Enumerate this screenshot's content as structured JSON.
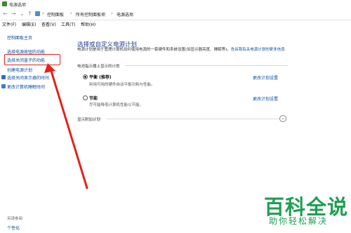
{
  "window": {
    "title": "电源选项"
  },
  "address": {
    "back": "←",
    "forward": "→",
    "recent": "⌄",
    "up": "↑",
    "crumbs": [
      "控制面板",
      "所有控制面板项",
      "电源选项"
    ],
    "sep": "›"
  },
  "menu": [
    "文件(F)",
    "编辑(E)",
    "查看(V)",
    "工具(T)",
    "帮助(H)"
  ],
  "sidebar": {
    "home": "控制面板主页",
    "items": [
      "选择电源按钮的功能",
      "选择关闭盖子的功能",
      "创建电源计划",
      "选择关闭显示器的时间",
      "更改计算机睡眠时间"
    ],
    "see_also": "另请参阅",
    "personalize": "个性化"
  },
  "main": {
    "title": "选择或自定义电源计划",
    "desc": "电源计划是用于管理计算机如何使用电源的一套硬件和系统设置(如显示器亮度、睡眠等)。",
    "desc_link": "告诉我有关电源计划的更多信息",
    "section": "电池指示器上显示的计划",
    "plans": [
      {
        "name": "平衡 (推荐)",
        "desc": "利用可用的硬件自动平衡功耗与性能。",
        "change": "更改计划设置",
        "selected": true
      },
      {
        "name": "节能",
        "desc": "尽可能降低计算机性能以节能。",
        "change": "更改计划设置",
        "selected": false
      }
    ],
    "extra": "显示附加计划"
  },
  "watermark": {
    "title": "百科全说",
    "subtitle": "助你轻松解决"
  },
  "colors": {
    "link": "#0b4fa1",
    "title": "#1e3f8a",
    "highlight": "#e2231a",
    "watermark": "#1f9e52"
  }
}
